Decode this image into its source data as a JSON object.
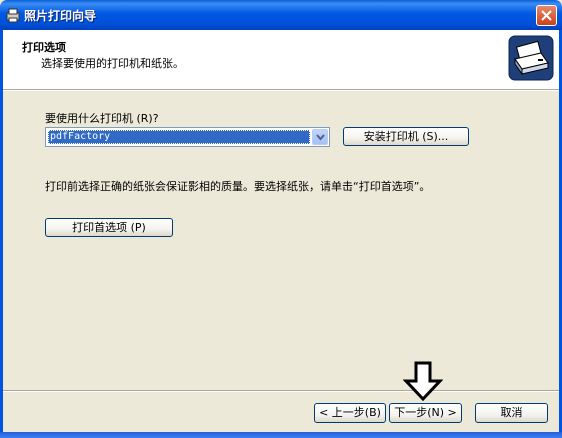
{
  "window": {
    "title": "照片打印向导"
  },
  "header": {
    "title": "打印选项",
    "subtitle": "选择要使用的打印机和纸张。",
    "icon": "printer-icon"
  },
  "printer": {
    "label": "要使用什么打印机 (R)?",
    "selected": "pdfFactory",
    "install_button": "安装打印机 (S)..."
  },
  "info": {
    "text": "打印前选择正确的纸张会保证影相的质量。要选择纸张，请单击“打印首选项”。"
  },
  "preferences": {
    "button": "打印首选项 (P)"
  },
  "footer": {
    "back_button": "< 上一步(B)",
    "next_button": "下一步(N) >",
    "cancel_button": "取消"
  },
  "colors": {
    "titlebar": "#0058e4",
    "window_bg": "#ece9d8",
    "selection": "#316ac5",
    "close_button": "#c8421b"
  }
}
